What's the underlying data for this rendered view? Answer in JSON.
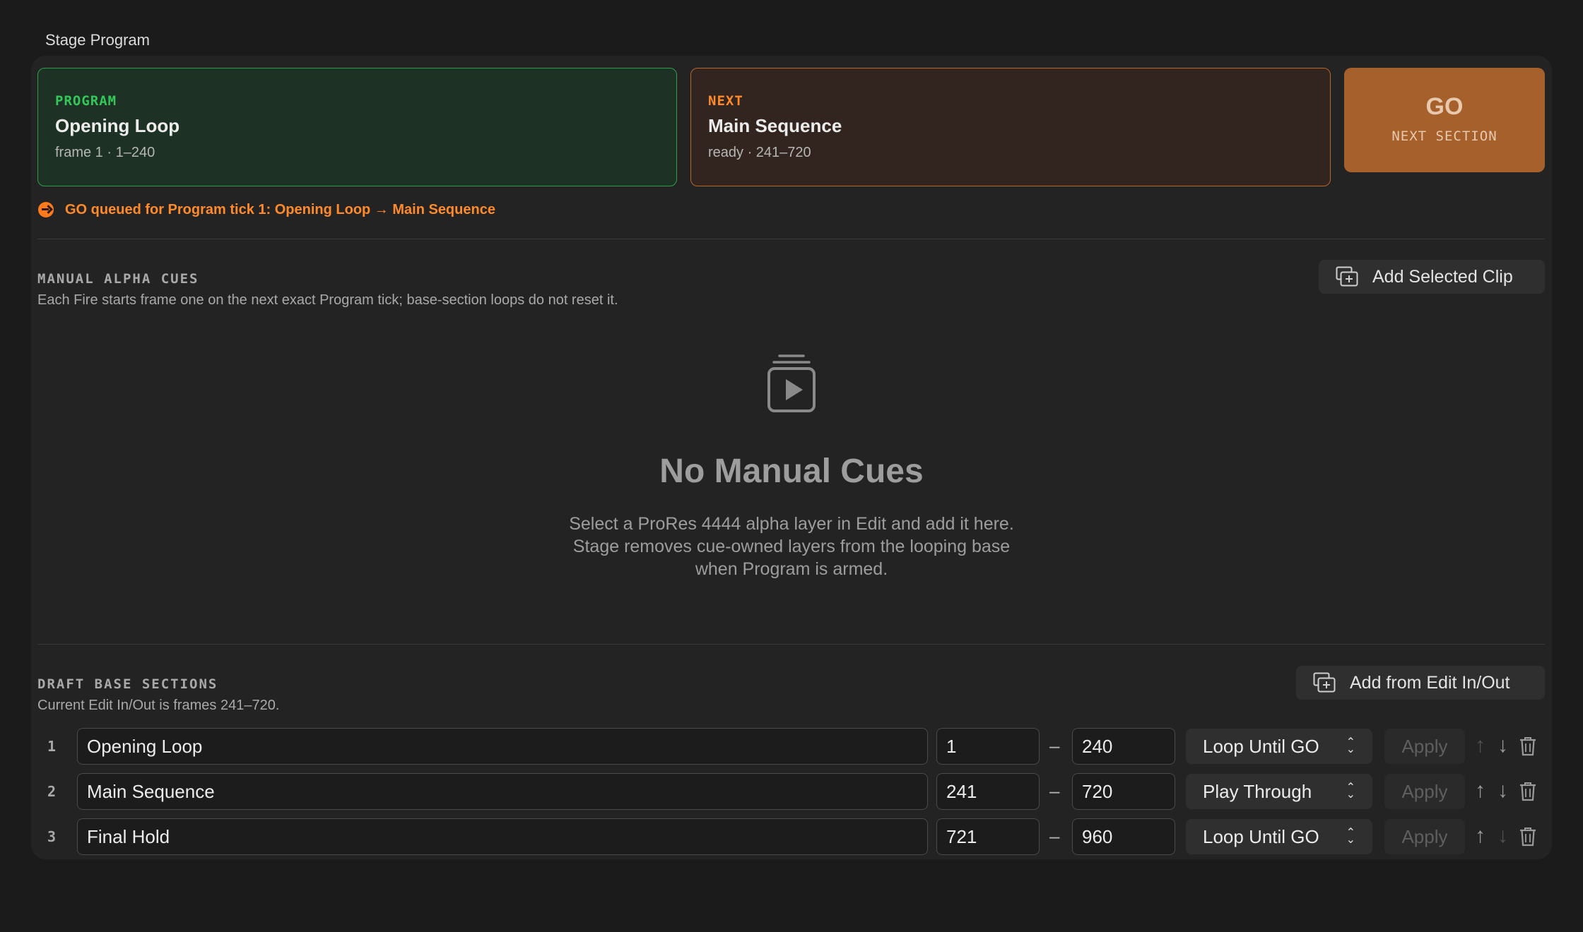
{
  "group_title": "Stage Program",
  "program_card": {
    "kicker": "PROGRAM",
    "name": "Opening Loop",
    "sub": "frame 1 · 1–240",
    "color": "#34c759"
  },
  "next_card": {
    "kicker": "NEXT",
    "name": "Main Sequence",
    "sub": "ready · 241–720",
    "color": "#ff8a2a"
  },
  "go_button": {
    "label": "GO",
    "sub": "NEXT SECTION"
  },
  "queued_message": {
    "icon": "arrow-circle-icon",
    "text": "GO queued for Program tick 1: Opening Loop → Main Sequence"
  },
  "manual_cues": {
    "heading": "MANUAL ALPHA CUES",
    "note": "Each Fire starts frame one on the next exact Program tick; base-section loops do not reset it.",
    "add_button": "Add Selected Clip",
    "empty_icon": "clip-stack-play-icon",
    "empty_title": "No Manual Cues",
    "empty_lines": [
      "Select a ProRes 4444 alpha layer in Edit and add it here.",
      "Stage removes cue-owned layers from the looping base",
      "when Program is armed."
    ]
  },
  "base_sections": {
    "heading": "DRAFT BASE SECTIONS",
    "note": "Current Edit In/Out is frames 241–720.",
    "add_button": "Add from Edit In/Out",
    "apply_label": "Apply",
    "separator": "–",
    "rows": [
      {
        "index": "1",
        "name": "Opening Loop",
        "in": "1",
        "out": "240",
        "mode": "Loop Until GO",
        "up_enabled": false,
        "down_enabled": true
      },
      {
        "index": "2",
        "name": "Main Sequence",
        "in": "241",
        "out": "720",
        "mode": "Play Through",
        "up_enabled": true,
        "down_enabled": true
      },
      {
        "index": "3",
        "name": "Final Hold",
        "in": "721",
        "out": "960",
        "mode": "Loop Until GO",
        "up_enabled": true,
        "down_enabled": false
      }
    ]
  }
}
